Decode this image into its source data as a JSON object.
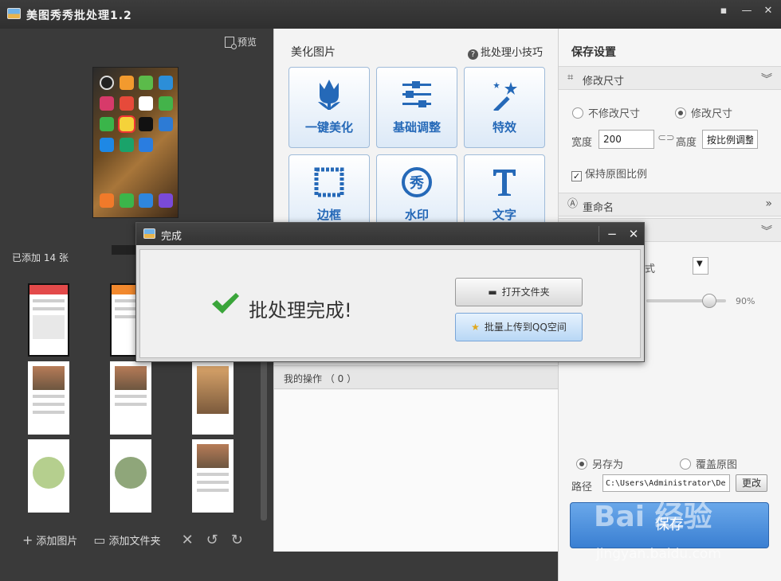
{
  "window": {
    "title": "美图秀秀批处理1.2",
    "controls": [
      "feedback",
      "minimize",
      "close"
    ]
  },
  "left": {
    "preview_label": "预览",
    "added_count_label": "已添加 14 张",
    "bottom": {
      "add_image": "添加图片",
      "add_folder": "添加文件夹"
    }
  },
  "middle": {
    "title": "美化图片",
    "tips": "批处理小技巧",
    "tools": [
      {
        "label": "一键美化",
        "icon": "tulip-icon"
      },
      {
        "label": "基础调整",
        "icon": "sliders-icon"
      },
      {
        "label": "特效",
        "icon": "magic-wand-icon"
      },
      {
        "label": "边框",
        "icon": "frame-icon"
      },
      {
        "label": "水印",
        "icon": "watermark-icon"
      },
      {
        "label": "文字",
        "icon": "text-icon"
      }
    ],
    "ops_label": "我的操作 （ 0 ）"
  },
  "right": {
    "title": "保存设置",
    "resize_section": "修改尺寸",
    "no_resize": "不修改尺寸",
    "resize": "修改尺寸",
    "width_label": "宽度",
    "width_value": "200",
    "height_label": "高度",
    "height_value": "按比例调整",
    "keep_ratio": "保持原图比例",
    "rename_section": "重命名",
    "format_suffix": "式",
    "quality": "90%",
    "save_as": "另存为",
    "overwrite": "覆盖原图",
    "path_label": "路径",
    "path_value": "C:\\Users\\Administrator\\De:",
    "change": "更改",
    "save": "保存"
  },
  "dialog": {
    "title": "完成",
    "message": "批处理完成!",
    "open_folder": "打开文件夹",
    "upload_qq": "批量上传到QQ空间"
  },
  "watermark": {
    "brand": "Bai 经验",
    "url": "jingyan.baidu.com"
  },
  "colors": {
    "accent": "#2569b8",
    "titlebar": "#333333",
    "save_button": "#4a8ede",
    "check": "#3aa53a"
  }
}
